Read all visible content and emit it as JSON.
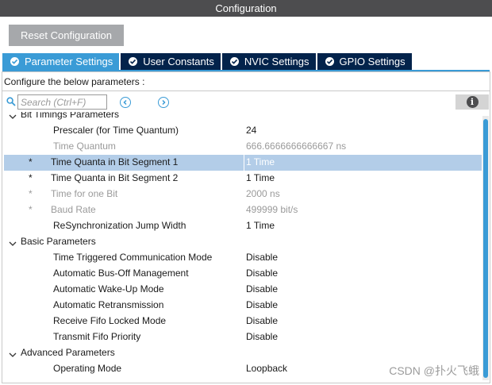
{
  "window": {
    "title": "Configuration"
  },
  "toolbar": {
    "reset_label": "Reset Configuration"
  },
  "tabs": [
    {
      "label": "Parameter Settings",
      "active": true
    },
    {
      "label": "User Constants",
      "active": false
    },
    {
      "label": "NVIC Settings",
      "active": false
    },
    {
      "label": "GPIO Settings",
      "active": false
    }
  ],
  "hint": "Configure the below parameters :",
  "search": {
    "placeholder": "Search (Ctrl+F)",
    "value": ""
  },
  "info_icon": "i",
  "sections": [
    {
      "title": "Bit Timings Parameters",
      "params": [
        {
          "name": "Prescaler (for Time Quantum)",
          "value": "24",
          "star": false,
          "disabled": false,
          "selected": false
        },
        {
          "name": "Time Quantum",
          "value": "666.6666666666667 ns",
          "star": false,
          "disabled": true,
          "selected": false
        },
        {
          "name": "Time Quanta in Bit Segment 1",
          "value": "1 Time",
          "star": true,
          "disabled": false,
          "selected": true
        },
        {
          "name": "Time Quanta in Bit Segment 2",
          "value": "1 Time",
          "star": true,
          "disabled": false,
          "selected": false
        },
        {
          "name": "Time for one Bit",
          "value": "2000 ns",
          "star": true,
          "disabled": true,
          "selected": false
        },
        {
          "name": "Baud Rate",
          "value": "499999 bit/s",
          "star": true,
          "disabled": true,
          "selected": false
        },
        {
          "name": "ReSynchronization Jump Width",
          "value": "1 Time",
          "star": false,
          "disabled": false,
          "selected": false
        }
      ]
    },
    {
      "title": "Basic Parameters",
      "params": [
        {
          "name": "Time Triggered Communication Mode",
          "value": "Disable",
          "star": false,
          "disabled": false,
          "selected": false
        },
        {
          "name": "Automatic Bus-Off Management",
          "value": "Disable",
          "star": false,
          "disabled": false,
          "selected": false
        },
        {
          "name": "Automatic Wake-Up Mode",
          "value": "Disable",
          "star": false,
          "disabled": false,
          "selected": false
        },
        {
          "name": "Automatic Retransmission",
          "value": "Disable",
          "star": false,
          "disabled": false,
          "selected": false
        },
        {
          "name": "Receive Fifo Locked Mode",
          "value": "Disable",
          "star": false,
          "disabled": false,
          "selected": false
        },
        {
          "name": "Transmit Fifo Priority",
          "value": "Disable",
          "star": false,
          "disabled": false,
          "selected": false
        }
      ]
    },
    {
      "title": "Advanced Parameters",
      "params": [
        {
          "name": "Operating Mode",
          "value": "Loopback",
          "star": false,
          "disabled": false,
          "selected": false
        }
      ]
    }
  ],
  "watermark": "CSDN @扑火飞蛾",
  "colors": {
    "accent": "#3a9bd6",
    "tab_dark": "#03234b",
    "title_bar": "#4d4d4f",
    "selection": "#b3cde8"
  }
}
